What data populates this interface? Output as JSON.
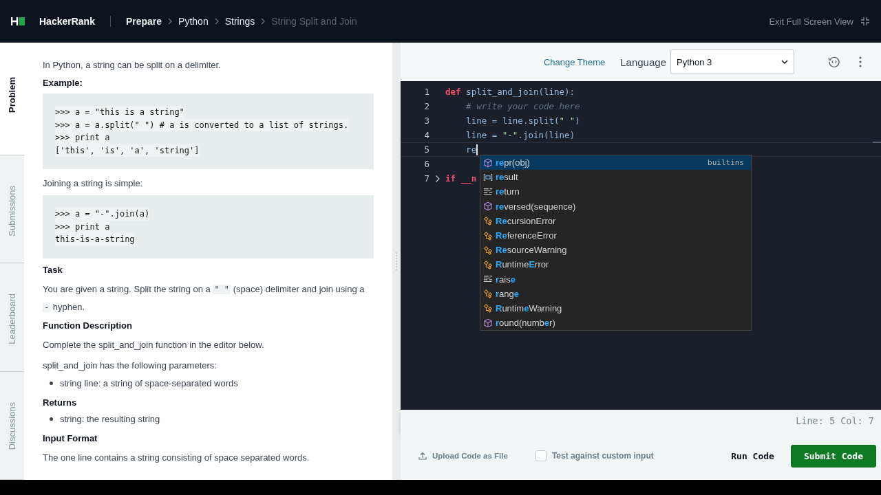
{
  "header": {
    "brand": "HackerRank",
    "breadcrumbs": [
      {
        "label": "Prepare",
        "current": false,
        "strong": true
      },
      {
        "label": "Python",
        "current": false,
        "strong": false
      },
      {
        "label": "Strings",
        "current": false,
        "strong": false
      },
      {
        "label": "String Split and Join",
        "current": true,
        "strong": false
      }
    ],
    "exit": "Exit Full Screen View"
  },
  "side_tabs": [
    {
      "label": "Problem",
      "selected": true
    },
    {
      "label": "Submissions",
      "selected": false
    },
    {
      "label": "Leaderboard",
      "selected": false
    },
    {
      "label": "Discussions",
      "selected": false
    }
  ],
  "problem": [
    {
      "kind": "paragraph",
      "parts": [
        {
          "text": "In Python, a string can be split on a delimiter.",
          "code": false
        }
      ]
    },
    {
      "kind": "heading",
      "text": "Example:"
    },
    {
      "kind": "code",
      "lines": [
        ">>> a = \"this is a string\"",
        ">>> a = a.split(\" \") # a is converted to a list of strings.",
        ">>> print a",
        "['this', 'is', 'a', 'string']"
      ]
    },
    {
      "kind": "paragraph",
      "parts": [
        {
          "text": "Joining a string is simple:",
          "code": false
        }
      ]
    },
    {
      "kind": "code",
      "lines": [
        ">>> a = \"-\".join(a)",
        ">>> print a",
        "this-is-a-string"
      ]
    },
    {
      "kind": "heading",
      "text": "Task"
    },
    {
      "kind": "paragraph",
      "parts": [
        {
          "text": "You are given a string. Split the string on a ",
          "code": false
        },
        {
          "text": "\" \"",
          "code": true
        },
        {
          "text": " (space) delimiter and join using a ",
          "code": false
        },
        {
          "text": "-",
          "code": true
        },
        {
          "text": " hyphen.",
          "code": false
        }
      ]
    },
    {
      "kind": "heading",
      "text": "Function Description"
    },
    {
      "kind": "paragraph",
      "parts": [
        {
          "text": "Complete the split_and_join function in the editor below.",
          "code": false
        }
      ]
    },
    {
      "kind": "paragraph",
      "parts": [
        {
          "text": "split_and_join has the following parameters:",
          "code": false
        }
      ]
    },
    {
      "kind": "bullet",
      "text": "string line: a string of space-separated words"
    },
    {
      "kind": "heading",
      "text": "Returns"
    },
    {
      "kind": "bullet",
      "text": "string: the resulting string"
    },
    {
      "kind": "heading",
      "text": "Input Format"
    },
    {
      "kind": "paragraph",
      "parts": [
        {
          "text": "The one line contains a string consisting of space separated words.",
          "code": false
        }
      ]
    }
  ],
  "editor": {
    "change_theme": "Change Theme",
    "language_label": "Language",
    "language": "Python 3",
    "lines": [
      {
        "number": "1",
        "current": false,
        "fold": false,
        "tokens": [
          {
            "text": "def",
            "kind": "keyword"
          },
          {
            "text": " split_and_join(line):",
            "kind": "plain"
          }
        ]
      },
      {
        "number": "2",
        "current": false,
        "fold": false,
        "tokens": [
          {
            "text": "    # write your code here",
            "kind": "comment"
          }
        ]
      },
      {
        "number": "3",
        "current": false,
        "fold": false,
        "tokens": [
          {
            "text": "    line = line.split(",
            "kind": "plain"
          },
          {
            "text": "\" \"",
            "kind": "string"
          },
          {
            "text": ")",
            "kind": "plain"
          }
        ]
      },
      {
        "number": "4",
        "current": false,
        "fold": false,
        "tokens": [
          {
            "text": "    line = ",
            "kind": "plain"
          },
          {
            "text": "\"-\"",
            "kind": "string"
          },
          {
            "text": ".join(line)",
            "kind": "plain"
          }
        ]
      },
      {
        "number": "5",
        "current": true,
        "fold": false,
        "tokens": [
          {
            "text": "    re",
            "kind": "plain"
          }
        ]
      },
      {
        "number": "6",
        "current": false,
        "fold": false
      },
      {
        "number": "7",
        "current": false,
        "fold": true,
        "tokens": [
          {
            "text": "if",
            "kind": "keyword"
          },
          {
            "text": " __n",
            "kind": "keyword"
          }
        ]
      }
    ],
    "suggestions": [
      {
        "kind": "function",
        "selected": true,
        "source": "builtins",
        "parts": [
          {
            "text": "re",
            "match": true
          },
          {
            "text": "pr(obj)",
            "match": false
          }
        ]
      },
      {
        "kind": "variable",
        "selected": false,
        "parts": [
          {
            "text": "re",
            "match": true
          },
          {
            "text": "sult",
            "match": false
          }
        ]
      },
      {
        "kind": "keyword",
        "selected": false,
        "parts": [
          {
            "text": "re",
            "match": true
          },
          {
            "text": "turn",
            "match": false
          }
        ]
      },
      {
        "kind": "function",
        "selected": false,
        "parts": [
          {
            "text": "re",
            "match": true
          },
          {
            "text": "versed(sequence)",
            "match": false
          }
        ]
      },
      {
        "kind": "class",
        "selected": false,
        "parts": [
          {
            "text": "Re",
            "match": true
          },
          {
            "text": "cursionError",
            "match": false
          }
        ]
      },
      {
        "kind": "class",
        "selected": false,
        "parts": [
          {
            "text": "Re",
            "match": true
          },
          {
            "text": "ferenceError",
            "match": false
          }
        ]
      },
      {
        "kind": "class",
        "selected": false,
        "parts": [
          {
            "text": "Re",
            "match": true
          },
          {
            "text": "sourceWarning",
            "match": false
          }
        ]
      },
      {
        "kind": "class",
        "selected": false,
        "parts": [
          {
            "text": "R",
            "match": true
          },
          {
            "text": "untime",
            "match": false
          },
          {
            "text": "E",
            "match": true
          },
          {
            "text": "rror",
            "match": false
          }
        ]
      },
      {
        "kind": "keyword",
        "selected": false,
        "parts": [
          {
            "text": "r",
            "match": true
          },
          {
            "text": "ais",
            "match": false
          },
          {
            "text": "e",
            "match": true
          }
        ]
      },
      {
        "kind": "class",
        "selected": false,
        "parts": [
          {
            "text": "r",
            "match": true
          },
          {
            "text": "ang",
            "match": false
          },
          {
            "text": "e",
            "match": true
          }
        ]
      },
      {
        "kind": "class",
        "selected": false,
        "parts": [
          {
            "text": "R",
            "match": true
          },
          {
            "text": "untim",
            "match": false
          },
          {
            "text": "e",
            "match": true
          },
          {
            "text": "Warning",
            "match": false
          }
        ]
      },
      {
        "kind": "function",
        "selected": false,
        "parts": [
          {
            "text": "r",
            "match": true
          },
          {
            "text": "ound(numb",
            "match": false
          },
          {
            "text": "e",
            "match": true
          },
          {
            "text": "r)",
            "match": false
          }
        ]
      }
    ],
    "status": "Line: 5 Col: 7"
  },
  "actions": {
    "upload": "Upload Code as File",
    "custom_input": {
      "label": "Test against custom input",
      "checked": false
    },
    "run": "Run Code",
    "submit": "Submit Code"
  }
}
